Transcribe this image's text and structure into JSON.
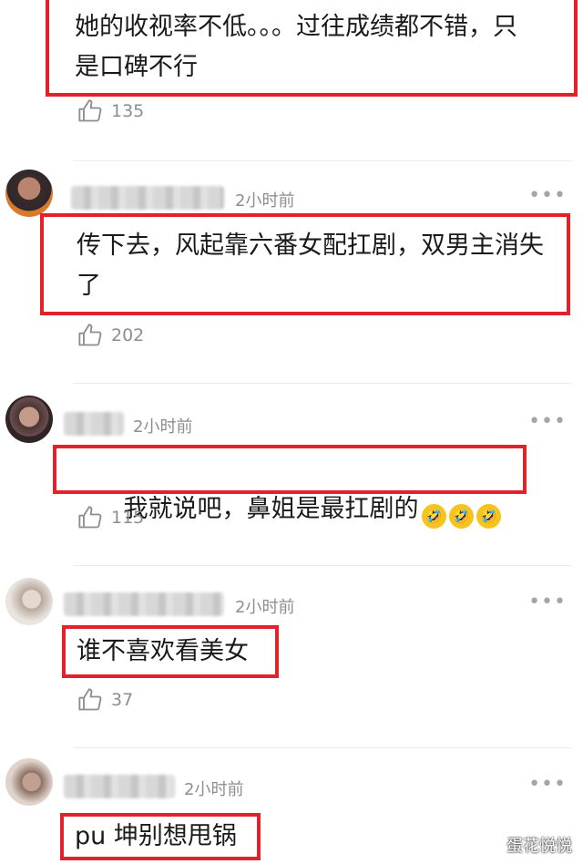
{
  "comments": [
    {
      "id": "c1",
      "text": "她的收视率不低。。。过往成绩都不错，只\n是口碑不行",
      "likes": "135",
      "time": ""
    },
    {
      "id": "c2",
      "text": "传下去，风起靠六番女配扛剧，双男主消失\n了",
      "likes": "202",
      "time": "2小时前"
    },
    {
      "id": "c3",
      "text": "我就说吧，鼻姐是最扛剧的",
      "likes": "115",
      "time": "2小时前",
      "emoji": "🤣"
    },
    {
      "id": "c4",
      "text": "谁不喜欢看美女",
      "likes": "37",
      "time": "2小时前"
    },
    {
      "id": "c5",
      "text": "pu 坤别想甩锅",
      "likes": "",
      "time": "2小时前"
    }
  ],
  "more_icon": "•••",
  "watermark": "蛋花悦悦",
  "colors": {
    "highlight": "#e2212a",
    "meta": "#8e8e8e"
  }
}
